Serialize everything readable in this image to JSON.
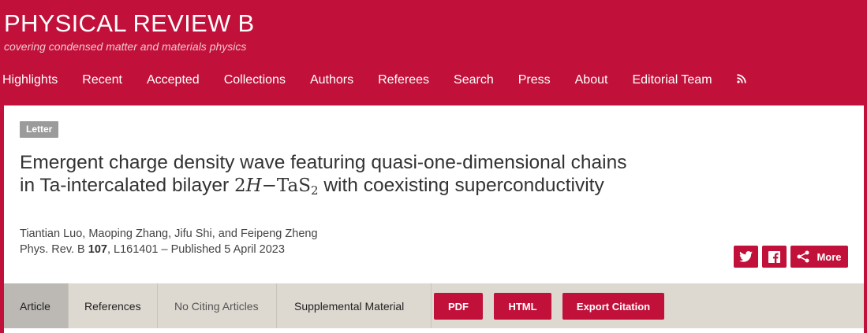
{
  "journal": {
    "title": "PHYSICAL REVIEW B",
    "tagline": "covering condensed matter and materials physics"
  },
  "nav": {
    "items": [
      "Highlights",
      "Recent",
      "Accepted",
      "Collections",
      "Authors",
      "Referees",
      "Search",
      "Press",
      "About",
      "Editorial Team"
    ],
    "rss_icon": "rss-icon"
  },
  "article": {
    "type": "Letter",
    "title_part1": "Emergent charge density wave featuring quasi-one-dimensional chains in Ta-intercalated bilayer",
    "math_coeff": "2",
    "math_var": "H",
    "math_dash": "−",
    "math_formula": "TaS",
    "math_sub": "2",
    "title_part2": "with coexisting superconductivity",
    "authors": "Tiantian Luo, Maoping Zhang, Jifu Shi, and Feipeng Zheng",
    "journal_abbr": "Phys. Rev. B",
    "volume": "107",
    "citation_rest": ", L161401 – Published 5 April 2023"
  },
  "share": {
    "more_label": "More",
    "icons": [
      "twitter-icon",
      "facebook-icon",
      "share-icon"
    ]
  },
  "tabs": [
    "Article",
    "References",
    "No Citing Articles",
    "Supplemental Material"
  ],
  "actions": {
    "pdf": "PDF",
    "html": "HTML",
    "export": "Export Citation"
  },
  "colors": {
    "brand": "#c1113a",
    "tabbar": "#ddd8d0",
    "active_tab": "#bcb9b4",
    "badge": "#9b9b9b"
  }
}
